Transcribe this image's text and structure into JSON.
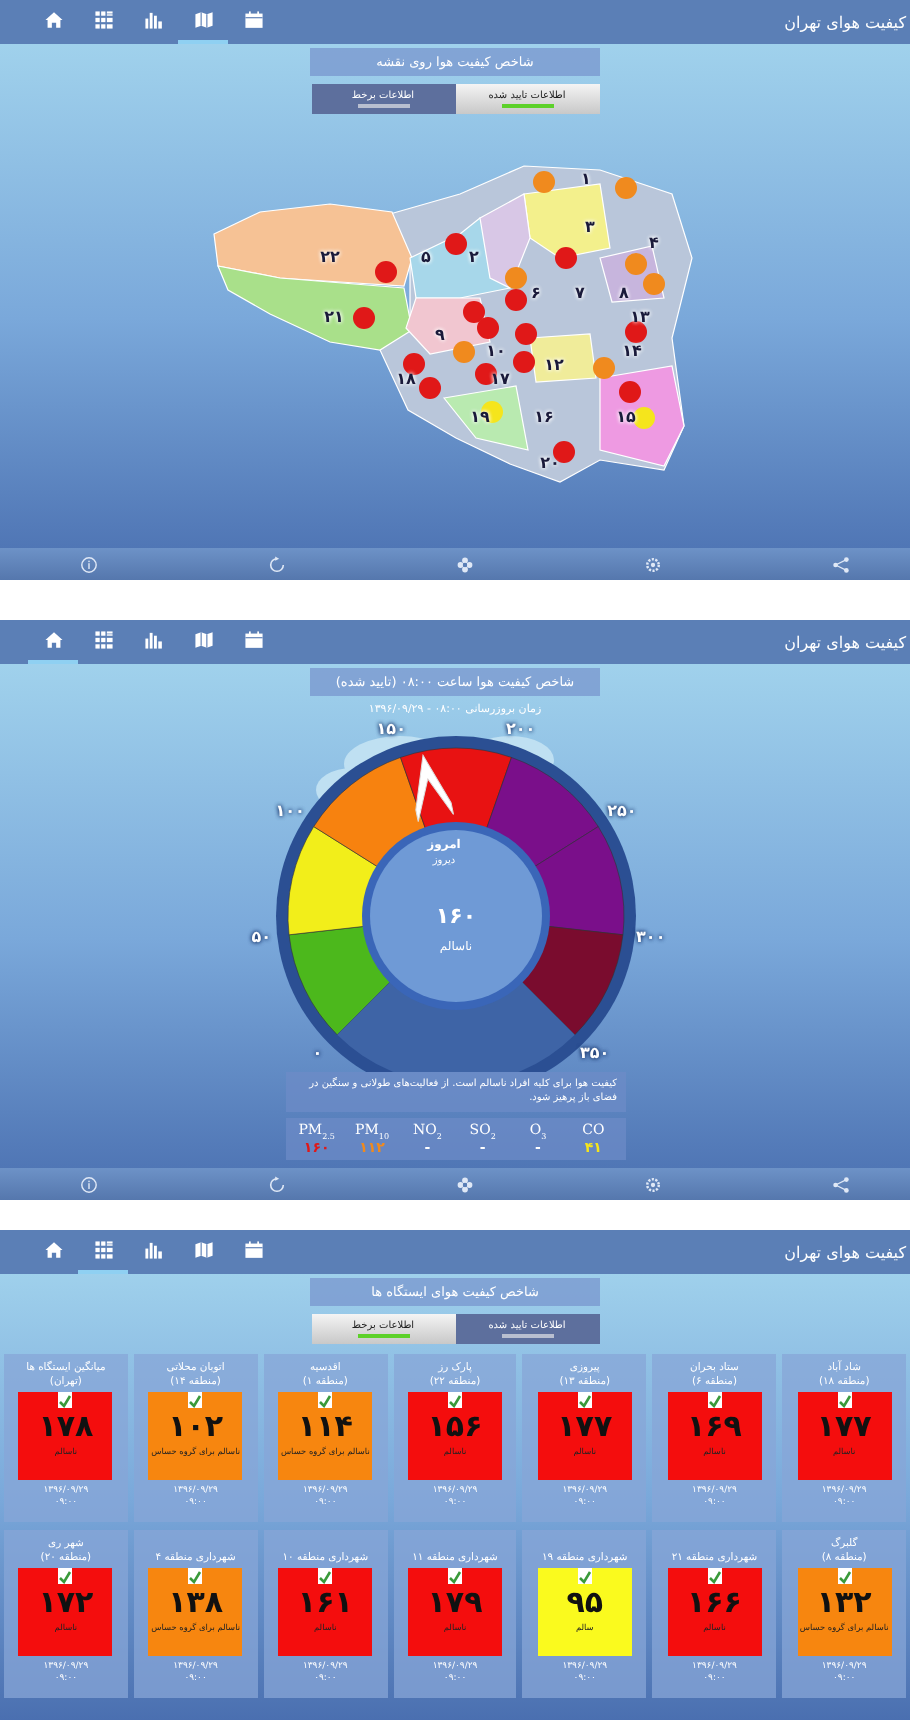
{
  "screens": [
    {
      "kind": "map",
      "app_title": "کیفیت هوای تهران",
      "nav": [
        {
          "kind": "home",
          "selected": false
        },
        {
          "kind": "grid",
          "selected": false
        },
        {
          "kind": "chart",
          "selected": false
        },
        {
          "kind": "map",
          "selected": true
        },
        {
          "kind": "calendar",
          "selected": false
        }
      ],
      "title": "شاخص کیفیت هوا روی نقشه",
      "toggles": [
        {
          "label": "اطلاعات تایید شده",
          "selected": true
        },
        {
          "label": "اطلاعات برخط",
          "selected": false
        }
      ],
      "districts": [
        "۱",
        "۳",
        "۴",
        "۲",
        "۵",
        "۲۲",
        "۸",
        "۷",
        "۶",
        "۱۳",
        "۲۱",
        "۹",
        "۱۴",
        "۱۰",
        "۱۲",
        "۱۷",
        "۱۸",
        "۱۵",
        "۱۶",
        "۱۹",
        "۲۰"
      ],
      "markers": [
        {
          "color": "#f08a1e"
        },
        {
          "color": "#f08a1e"
        },
        {
          "color": "#e01818"
        },
        {
          "color": "#e01818"
        },
        {
          "color": "#e01818"
        },
        {
          "color": "#f08a1e"
        },
        {
          "color": "#e01818"
        },
        {
          "color": "#f08a1e"
        },
        {
          "color": "#f08a1e"
        },
        {
          "color": "#e01818"
        },
        {
          "color": "#e01818"
        },
        {
          "color": "#e01818"
        },
        {
          "color": "#e01818"
        },
        {
          "color": "#e01818"
        },
        {
          "color": "#e01818"
        },
        {
          "color": "#e01818"
        },
        {
          "color": "#f08a1e"
        },
        {
          "color": "#e01818"
        },
        {
          "color": "#e01818"
        },
        {
          "color": "#f08a1e"
        },
        {
          "color": "#e01818"
        },
        {
          "color": "#f5e51c"
        },
        {
          "color": "#f5e51c"
        },
        {
          "color": "#e01818"
        }
      ]
    },
    {
      "kind": "gauge",
      "app_title": "کیفیت هوای تهران",
      "nav": [
        {
          "kind": "home",
          "selected": true
        },
        {
          "kind": "grid",
          "selected": false
        },
        {
          "kind": "chart",
          "selected": false
        },
        {
          "kind": "map",
          "selected": false
        },
        {
          "kind": "calendar",
          "selected": false
        }
      ],
      "title": "شاخص کیفیت هوا ساعت ۰۸:۰۰ (تایید شده)",
      "subtitle": "زمان بروزرسانی ۰۸:۰۰ - ۱۳۹۶/۰۹/۲۹",
      "gauge": {
        "ticks": [
          "۰",
          "۵۰",
          "۱۰۰",
          "۱۵۰",
          "۲۰۰",
          "۲۵۰",
          "۳۰۰",
          "۳۵۰"
        ],
        "bands": [
          {
            "color": "#4cb81c"
          },
          {
            "color": "#f2ee1a"
          },
          {
            "color": "#f7820f"
          },
          {
            "color": "#e81212"
          },
          {
            "color": "#7a0f8a"
          },
          {
            "color": "#7a0f8a"
          },
          {
            "color": "#7a0c2e"
          }
        ],
        "level": 0.457,
        "today": "امروز",
        "yesterday": "دیروز",
        "value": "۱۶۰",
        "category": "ناسالم"
      },
      "message": "کیفیت هوا برای کلیه افراد ناسالم است. از فعالیت‌های طولانی و سنگین در فضای باز پرهیز شود.",
      "pollutants": [
        {
          "label": "CO",
          "value": "۴۱",
          "color": "#f5e51c"
        },
        {
          "label": "O$_{3}$",
          "value": "-"
        },
        {
          "label": "SO$_{2}$",
          "value": "-"
        },
        {
          "label": "NO$_{2}$",
          "value": "-"
        },
        {
          "label": "PM$_{10}$",
          "value": "۱۱۲",
          "color": "#f08a1e"
        },
        {
          "label": "PM$_{2.5}$",
          "value": "۱۶۰",
          "color": "#e01818"
        }
      ]
    },
    {
      "kind": "stations",
      "app_title": "کیفیت هوای تهران",
      "nav": [
        {
          "kind": "home",
          "selected": false
        },
        {
          "kind": "grid",
          "selected": true
        },
        {
          "kind": "chart",
          "selected": false
        },
        {
          "kind": "map",
          "selected": false
        },
        {
          "kind": "calendar",
          "selected": false
        }
      ],
      "title": "شاخص کیفیت هوای ایستگاه ها",
      "toggles": [
        {
          "label": "اطلاعات تایید شده",
          "selected": false
        },
        {
          "label": "اطلاعات برخط",
          "selected": true
        }
      ],
      "stations": [
        {
          "name": "شاد آباد",
          "area": "(منطقه ۱۸)",
          "value": "۱۷۷",
          "category": "ناسالم",
          "color": "#f40d0d",
          "date": "۱۳۹۶/۰۹/۲۹",
          "time": "۰۹:۰۰"
        },
        {
          "name": "ستاد بحران",
          "area": "(منطقه ۶)",
          "value": "۱۶۹",
          "category": "ناسالم",
          "color": "#f40d0d",
          "date": "۱۳۹۶/۰۹/۲۹",
          "time": "۰۹:۰۰"
        },
        {
          "name": "پیروزی",
          "area": "(منطقه ۱۳)",
          "value": "۱۷۷",
          "category": "ناسالم",
          "color": "#f40d0d",
          "date": "۱۳۹۶/۰۹/۲۹",
          "time": "۰۹:۰۰"
        },
        {
          "name": "پارک رز",
          "area": "(منطقه ۲۲)",
          "value": "۱۵۶",
          "category": "ناسالم",
          "color": "#f40d0d",
          "date": "۱۳۹۶/۰۹/۲۹",
          "time": "۰۹:۰۰"
        },
        {
          "name": "اقدسیه",
          "area": "(منطقه ۱)",
          "value": "۱۱۴",
          "category": "ناسالم برای گروه حساس",
          "color": "#f7860f",
          "date": "۱۳۹۶/۰۹/۲۹",
          "time": "۰۹:۰۰"
        },
        {
          "name": "اتوبان محلاتی",
          "area": "(منطقه ۱۴)",
          "value": "۱۰۲",
          "category": "ناسالم برای گروه حساس",
          "color": "#f7860f",
          "date": "۱۳۹۶/۰۹/۲۹",
          "time": "۰۹:۰۰"
        },
        {
          "name": "میانگین ایستگاه ها",
          "area": "(تهران)",
          "value": "۱۷۸",
          "category": "ناسالم",
          "color": "#f40d0d",
          "date": "۱۳۹۶/۰۹/۲۹",
          "time": "۰۹:۰۰"
        },
        {
          "name": "گلبرگ",
          "area": "(منطقه ۸)",
          "value": "۱۳۲",
          "category": "ناسالم برای گروه حساس",
          "color": "#f7860f",
          "date": "۱۳۹۶/۰۹/۲۹",
          "time": "۰۹:۰۰"
        },
        {
          "name": "شهرداری منطقه ۲۱",
          "value": "۱۶۶",
          "category": "ناسالم",
          "color": "#f40d0d",
          "date": "۱۳۹۶/۰۹/۲۹",
          "time": "۰۹:۰۰"
        },
        {
          "name": "شهرداری منطقه ۱۹",
          "value": "۹۵",
          "category": "سالم",
          "color": "#fafa1e",
          "date": "۱۳۹۶/۰۹/۲۹",
          "time": "۰۹:۰۰"
        },
        {
          "name": "شهرداری منطقه ۱۱",
          "value": "۱۷۹",
          "category": "ناسالم",
          "color": "#f40d0d",
          "date": "۱۳۹۶/۰۹/۲۹",
          "time": "۰۹:۰۰"
        },
        {
          "name": "شهرداری منطقه ۱۰",
          "value": "۱۶۱",
          "category": "ناسالم",
          "color": "#f40d0d",
          "date": "۱۳۹۶/۰۹/۲۹",
          "time": "۰۹:۰۰"
        },
        {
          "name": "شهرداری منطقه ۴",
          "value": "۱۳۸",
          "category": "ناسالم برای گروه حساس",
          "color": "#f7860f",
          "date": "۱۳۹۶/۰۹/۲۹",
          "time": "۰۹:۰۰"
        },
        {
          "name": "شهر ری",
          "area": "(منطقه ۲۰)",
          "value": "۱۷۲",
          "category": "ناسالم",
          "color": "#f40d0d",
          "date": "۱۳۹۶/۰۹/۲۹",
          "time": "۰۹:۰۰"
        }
      ]
    }
  ]
}
